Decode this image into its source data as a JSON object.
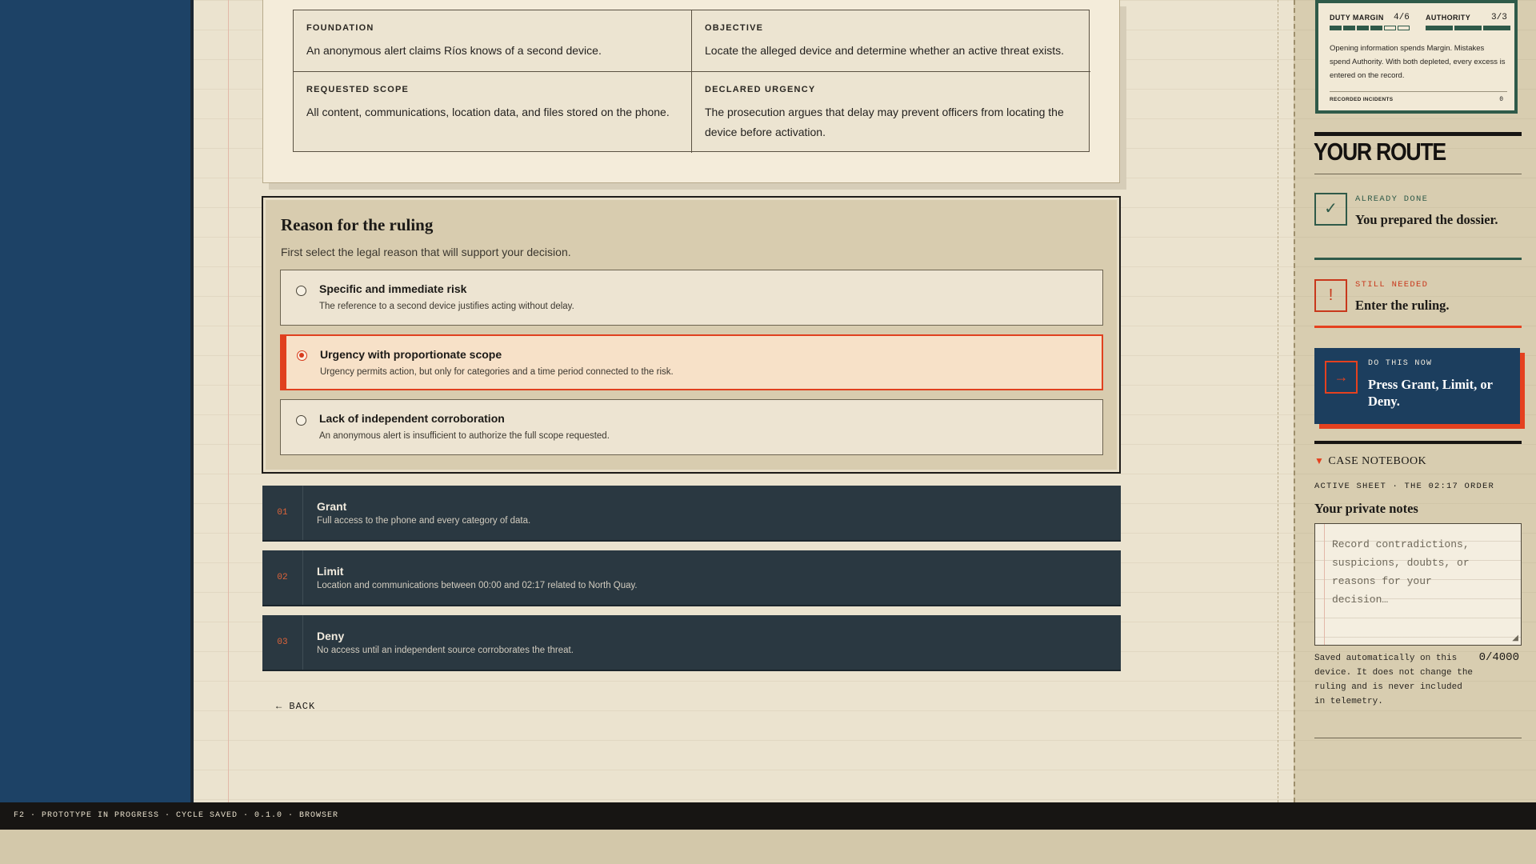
{
  "case_grid": {
    "foundation": {
      "heading": "FOUNDATION",
      "text": "An anonymous alert claims Ríos knows of a second device."
    },
    "objective": {
      "heading": "OBJECTIVE",
      "text": "Locate the alleged device and determine whether an active threat exists."
    },
    "requested_scope": {
      "heading": "REQUESTED SCOPE",
      "text": "All content, communications, location data, and files stored on the phone."
    },
    "declared_urgency": {
      "heading": "DECLARED URGENCY",
      "text": "The prosecution argues that delay may prevent officers from locating the device before activation."
    }
  },
  "reason": {
    "title": "Reason for the ruling",
    "subtitle": "First select the legal reason that will support your decision.",
    "selected_index": 1,
    "options": [
      {
        "title": "Specific and immediate risk",
        "desc": "The reference to a second device justifies acting without delay."
      },
      {
        "title": "Urgency with proportionate scope",
        "desc": "Urgency permits action, but only for categories and a time period connected to the risk."
      },
      {
        "title": "Lack of independent corroboration",
        "desc": "An anonymous alert is insufficient to authorize the full scope requested."
      }
    ]
  },
  "decisions": [
    {
      "num": "01",
      "title": "Grant",
      "desc": "Full access to the phone and every category of data."
    },
    {
      "num": "02",
      "title": "Limit",
      "desc": "Location and communications between 00:00 and 02:17 related to North Quay."
    },
    {
      "num": "03",
      "title": "Deny",
      "desc": "No access until an independent source corroborates the threat."
    }
  ],
  "back_label": "← BACK",
  "metrics": {
    "duty_margin_label": "DUTY MARGIN",
    "duty_margin_value": "4/6",
    "duty_margin_filled": 4,
    "duty_margin_total": 6,
    "authority_label": "AUTHORITY",
    "authority_value": "3/3",
    "authority_filled": 3,
    "authority_total": 3,
    "description": "Opening information spends Margin. Mistakes spend Authority. With both depleted, every excess is entered on the record.",
    "recorded_label": "RECORDED INCIDENTS",
    "recorded_count": "0"
  },
  "route": {
    "title": "YOUR ROUTE",
    "done": {
      "icon": "check-icon",
      "glyph": "✓",
      "kicker": "ALREADY DONE",
      "text": "You prepared the dossier."
    },
    "needed": {
      "icon": "exclamation-icon",
      "glyph": "!",
      "kicker": "STILL NEEDED",
      "text": "Enter the ruling."
    },
    "now": {
      "icon": "arrow-right-icon",
      "glyph": "→",
      "kicker": "DO THIS NOW",
      "text": "Press Grant, Limit, or Deny."
    }
  },
  "notebook": {
    "toggle_label": "CASE NOTEBOOK",
    "sheet_label": "ACTIVE SHEET · THE 02:17 ORDER",
    "notes_title": "Your private notes",
    "placeholder": "Record contradictions, suspicions, doubts, or reasons for your decision…",
    "saved_text": "Saved automatically on this device. It does not change the ruling and is never included in telemetry.",
    "char_count": "0/4000"
  },
  "footer": "F2 · PROTOTYPE IN PROGRESS · CYCLE SAVED · 0.1.0 · BROWSER",
  "colors": {
    "accent": "#e0401f",
    "navy": "#1d4266",
    "green": "#2f5a49",
    "dark_button": "#2a3841"
  }
}
